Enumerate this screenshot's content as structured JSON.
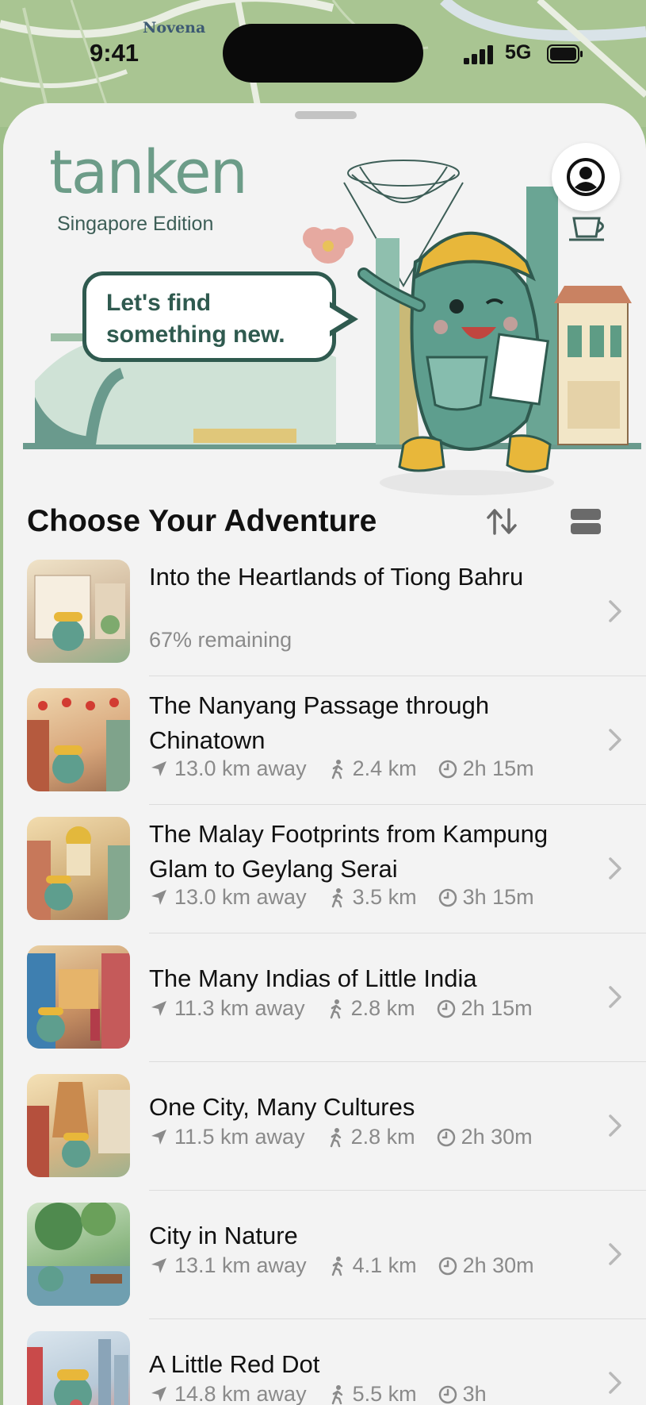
{
  "status": {
    "time": "9:41",
    "network": "5G"
  },
  "map": {
    "label": "Novena"
  },
  "hero": {
    "brand": "tanken",
    "edition": "Singapore Edition",
    "bubble": "Let's find something new."
  },
  "section": {
    "title": "Choose Your Adventure"
  },
  "adventures": [
    {
      "title": "Into the Heartlands of Tiong Bahru",
      "progress": "67% remaining"
    },
    {
      "title": "The Nanyang Passage through Chinatown",
      "distance": "13.0 km away",
      "length": "2.4 km",
      "duration": "2h 15m"
    },
    {
      "title": "The Malay Footprints from Kampung Glam to Geylang Serai",
      "distance": "13.0 km away",
      "length": "3.5 km",
      "duration": "3h 15m"
    },
    {
      "title": "The Many Indias of Little India",
      "distance": "11.3 km away",
      "length": "2.8 km",
      "duration": "2h 15m"
    },
    {
      "title": "One City, Many Cultures",
      "distance": "11.5 km away",
      "length": "2.8 km",
      "duration": "2h 30m"
    },
    {
      "title": "City in Nature",
      "distance": "13.1 km away",
      "length": "4.1 km",
      "duration": "2h 30m"
    },
    {
      "title": "A Little Red Dot",
      "distance": "14.8 km away",
      "length": "5.5 km",
      "duration": "3h"
    }
  ]
}
